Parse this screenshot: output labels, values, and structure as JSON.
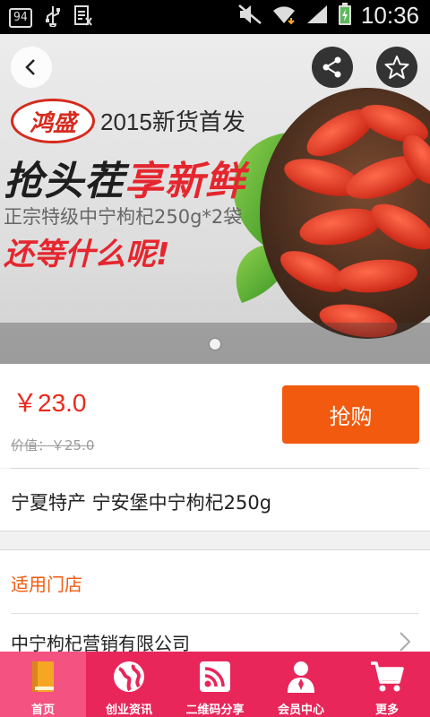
{
  "status_bar": {
    "badge": "94",
    "time": "10:36"
  },
  "banner": {
    "brand": "鸿盛",
    "year_text": "2015新货首发",
    "headline_a": "抢头茬",
    "headline_b": "享新鲜",
    "subline": "正宗特级中宁枸杞250g*2袋",
    "cta": "还等什么呢!",
    "page_count": 1,
    "current_page": 1
  },
  "product": {
    "price": "￥23.0",
    "original_price": "价值：￥25.0",
    "buy_label": "抢购",
    "title": "宁夏特产 宁安堡中宁枸杞250g"
  },
  "stores": {
    "header": "适用门店",
    "items": [
      "中宁枸杞营销有限公司"
    ]
  },
  "tabbar": {
    "items": [
      {
        "label": "首页",
        "icon": "book-icon",
        "active": true
      },
      {
        "label": "创业资讯",
        "icon": "globe-icon",
        "active": false
      },
      {
        "label": "二维码分享",
        "icon": "rss-icon",
        "active": false
      },
      {
        "label": "会员中心",
        "icon": "user-icon",
        "active": false
      },
      {
        "label": "更多",
        "icon": "cart-icon",
        "active": false
      }
    ]
  },
  "colors": {
    "accent": "#f15a0f",
    "price": "#e8291c",
    "tabbar": "#e8265a",
    "tab_active": "#f45281"
  }
}
